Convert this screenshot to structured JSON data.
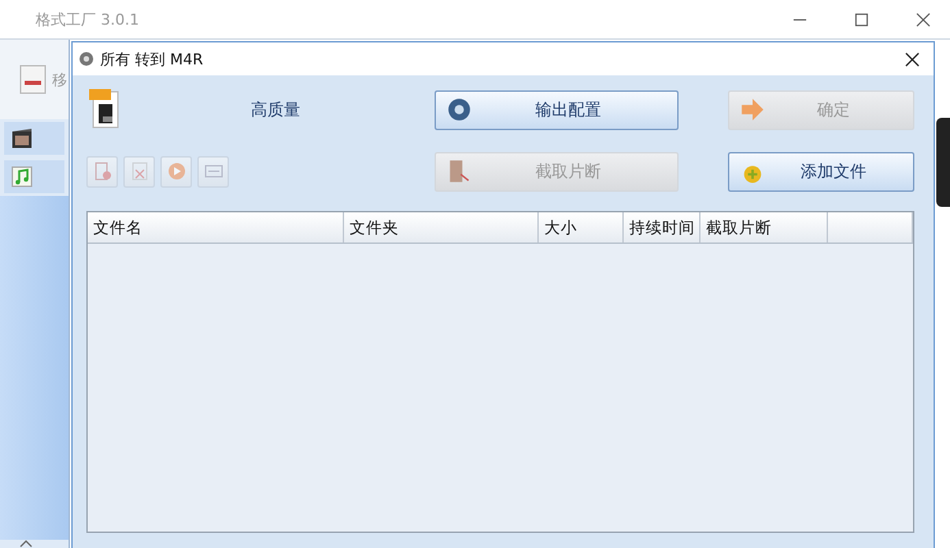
{
  "app_window": {
    "title": "格式工厂 3.0.1",
    "side_label": "移"
  },
  "dialog": {
    "title": "所有 转到 M4R",
    "quality": "高质量",
    "buttons": [
      {
        "label": "输出配置",
        "kind": "settings",
        "disabled": false
      },
      {
        "label": "确定",
        "kind": "arrow",
        "disabled": true
      },
      {
        "label": "截取片断",
        "kind": "clip",
        "disabled": true
      },
      {
        "label": "添加文件",
        "kind": "add",
        "disabled": false
      }
    ],
    "tools": [
      {
        "kind": "remove",
        "disabled": true
      },
      {
        "kind": "cut",
        "disabled": true
      },
      {
        "kind": "play",
        "disabled": true
      },
      {
        "kind": "info",
        "disabled": true
      }
    ],
    "table": {
      "columns": [
        "文件名",
        "文件夹",
        "大小",
        "持续时间",
        "截取片断"
      ]
    }
  }
}
